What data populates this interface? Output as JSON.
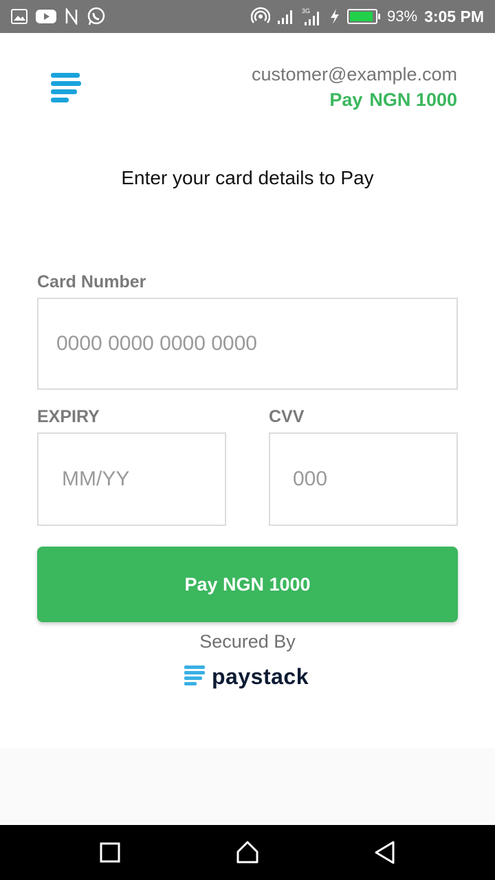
{
  "status_bar": {
    "battery_percent": "93%",
    "battery_level": 0.93,
    "time": "3:05 PM",
    "network": "3G",
    "icons": [
      "gallery-icon",
      "youtube-icon",
      "n-icon",
      "whatsapp-icon",
      "hotspot-icon",
      "signal-icon",
      "signal-3g-icon",
      "charging-icon",
      "battery-icon"
    ]
  },
  "header": {
    "email": "customer@example.com",
    "pay_label": "Pay",
    "amount": "NGN 1000"
  },
  "heading": "Enter your card details to Pay",
  "form": {
    "card_number_label": "Card Number",
    "card_number_placeholder": "0000 0000 0000 0000",
    "expiry_label": "EXPIRY",
    "expiry_placeholder": "MM/YY",
    "cvv_label": "CVV",
    "cvv_placeholder": "000"
  },
  "pay_button": "Pay NGN 1000",
  "secured_by": "Secured By",
  "brand": "paystack",
  "colors": {
    "accent_green": "#3bb75e",
    "brand_blue": "#1aa3dc",
    "brand_dark": "#0d1b33"
  }
}
